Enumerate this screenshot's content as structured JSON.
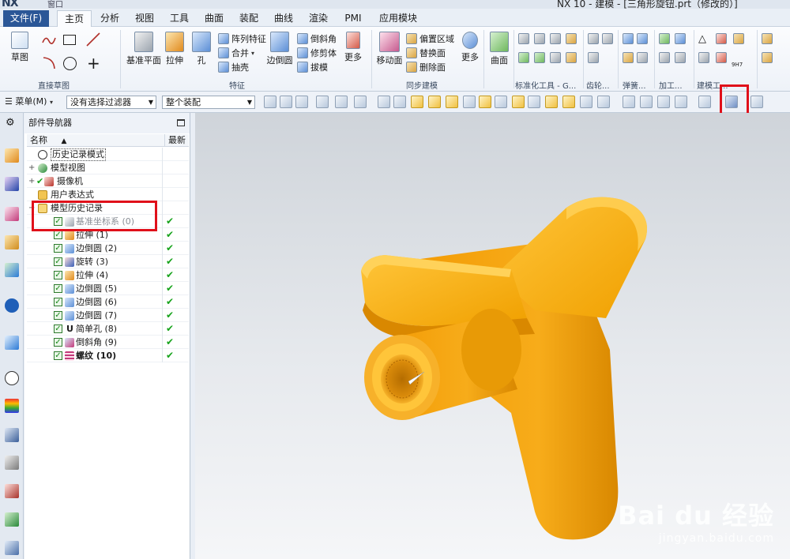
{
  "titlebar": {
    "logo": "NX",
    "quick_access": "窗口",
    "title": "NX 10 - 建模 - [三角形旋钮.prt（修改的）]"
  },
  "tabs": [
    {
      "label": "文件(F)"
    },
    {
      "label": "主页"
    },
    {
      "label": "分析"
    },
    {
      "label": "视图"
    },
    {
      "label": "工具"
    },
    {
      "label": "曲面"
    },
    {
      "label": "装配"
    },
    {
      "label": "曲线"
    },
    {
      "label": "渲染"
    },
    {
      "label": "PMI"
    },
    {
      "label": "应用模块"
    }
  ],
  "ribbon": {
    "sketch": "草图",
    "direct_sketch_group": "直接草图",
    "datum_plane": "基准平面",
    "extrude": "拉伸",
    "hole": "孔",
    "pattern_feature": "阵列特征",
    "unite": "合并",
    "shell": "抽壳",
    "edge_blend": "边倒圆",
    "chamfer": "倒斜角",
    "trim_body": "修剪体",
    "draft": "拔模",
    "more1": "更多",
    "feature_group": "特征",
    "move_face": "移动面",
    "offset_region": "偏置区域",
    "replace_face": "替换面",
    "delete_face": "删除面",
    "more2": "更多",
    "sync_group": "同步建模",
    "surface": "曲面",
    "std_tools_group": "标准化工具 - G...",
    "gear_group": "齿轮...",
    "spring_group": "弹簧...",
    "machining_group": "加工...",
    "modeling_tools_group": "建模工...",
    "hole_label": "9H7"
  },
  "toolbar": {
    "menu": "菜单(M)",
    "filter": "没有选择过滤器",
    "assembly": "整个装配"
  },
  "navigator": {
    "title": "部件导航器",
    "col_name": "名称",
    "col_latest": "最新",
    "items": [
      {
        "label": "历史记录模式"
      },
      {
        "label": "模型视图"
      },
      {
        "label": "摄像机"
      },
      {
        "label": "用户表达式"
      },
      {
        "label": "模型历史记录"
      },
      {
        "label": "基准坐标系 (0)"
      },
      {
        "label": "拉伸 (1)"
      },
      {
        "label": "边倒圆 (2)"
      },
      {
        "label": "旋转 (3)"
      },
      {
        "label": "拉伸 (4)"
      },
      {
        "label": "边倒圆 (5)"
      },
      {
        "label": "边倒圆 (6)"
      },
      {
        "label": "边倒圆 (7)"
      },
      {
        "label": "简单孔 (8)"
      },
      {
        "label": "倒斜角 (9)"
      },
      {
        "label": "螺纹 (10)"
      }
    ]
  },
  "model": {
    "color": "#f3a107",
    "shade": "#c97d00",
    "highlight": "#ffc53a"
  },
  "watermark": {
    "brand": "Bai du 经验",
    "url": "jingyan.baidu.com"
  },
  "colors": {
    "highlight_box": "#e0101a",
    "check": "#17a31c",
    "file_tab": "#2b5797"
  }
}
